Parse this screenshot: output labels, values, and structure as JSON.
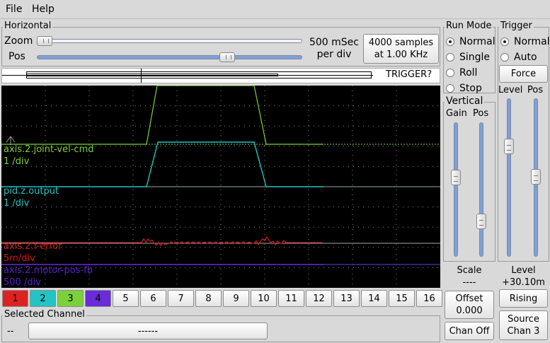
{
  "menu": {
    "file": "File",
    "help": "Help"
  },
  "horizontal": {
    "title": "Horizontal",
    "zoom_label": "Zoom",
    "pos_label": "Pos",
    "zoom_value": 0.0,
    "pos_value": 0.73,
    "time_per_div": "500 mSec",
    "per_div": "per div",
    "samples": "4000 samples",
    "rate": "at 1.00 KHz",
    "trigger_status": "TRIGGER?"
  },
  "run_mode": {
    "title": "Run Mode",
    "options": [
      "Normal",
      "Single",
      "Roll",
      "Stop"
    ],
    "selected": "Normal"
  },
  "trigger": {
    "title": "Trigger",
    "options": [
      "Normal",
      "Auto"
    ],
    "selected": "Normal",
    "force_label": "Force",
    "level_label": "Level",
    "pos_label": "Pos",
    "level_value_label": "Level",
    "level_value": "+30.10m",
    "edge_label": "Rising",
    "source_line1": "Source",
    "source_line2": "Chan  3"
  },
  "vertical": {
    "title": "Vertical",
    "gain_label": "Gain",
    "pos_label": "Pos",
    "scale_label": "Scale",
    "scale_value": "----",
    "offset_label": "Offset",
    "offset_value": "0.000",
    "chan_off_label": "Chan Off"
  },
  "traces": [
    {
      "name": "axis.2.joint-vel-cmd",
      "scale": "1 /div",
      "color": "#7bd13a"
    },
    {
      "name": "pid.z.output",
      "scale": "1 /div",
      "color": "#22c4c4"
    },
    {
      "name": "axis.2.f-error",
      "scale": "5m/div",
      "color": "#cc1a1a"
    },
    {
      "name": "axis.2.motor-pos-fb",
      "scale": "500 /div",
      "color": "#5a1fd0"
    }
  ],
  "channels": [
    {
      "label": "1",
      "color": "#dd2222"
    },
    {
      "label": "2",
      "color": "#22c4c4"
    },
    {
      "label": "3",
      "color": "#7bd13a"
    },
    {
      "label": "4",
      "color": "#6a2bd8"
    },
    {
      "label": "5"
    },
    {
      "label": "6"
    },
    {
      "label": "7"
    },
    {
      "label": "8"
    },
    {
      "label": "9"
    },
    {
      "label": "10"
    },
    {
      "label": "11"
    },
    {
      "label": "12"
    },
    {
      "label": "13"
    },
    {
      "label": "14"
    },
    {
      "label": "15"
    },
    {
      "label": "16"
    }
  ],
  "selected_channel": {
    "title": "Selected Channel",
    "number": "--",
    "name": "------"
  }
}
